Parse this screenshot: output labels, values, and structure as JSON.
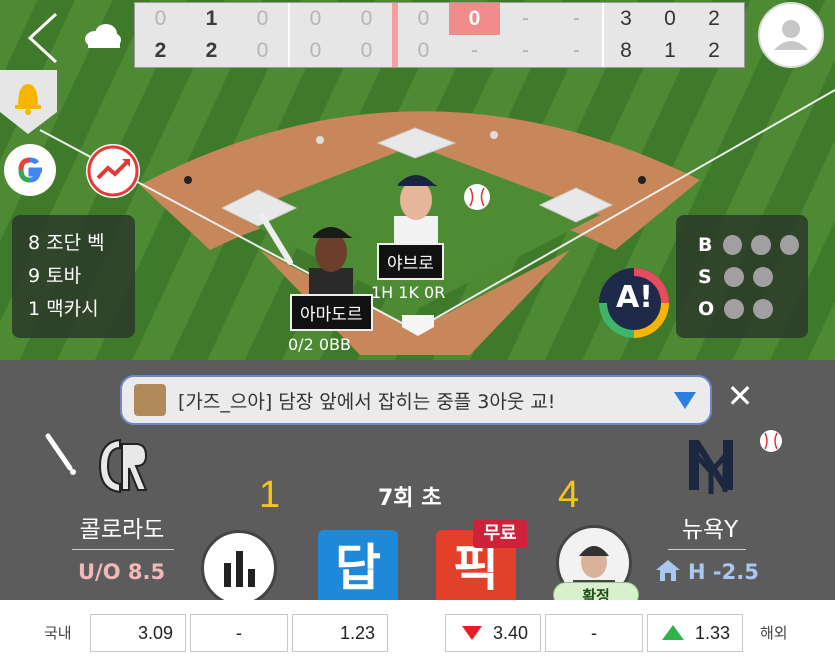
{
  "scoreboard": {
    "away_innings": [
      "0",
      "1",
      "0",
      "0",
      "0",
      "0",
      "0",
      "-",
      "-"
    ],
    "home_innings": [
      "2",
      "2",
      "0",
      "0",
      "0",
      "0",
      "-",
      "-",
      "-"
    ],
    "away_totals": [
      "3",
      "0",
      "2"
    ],
    "home_totals": [
      "8",
      "1",
      "2"
    ]
  },
  "lineup": [
    "8 조단 벡",
    "9 토바",
    "1 맥카시"
  ],
  "bso": {
    "balls": "B",
    "strikes": "S",
    "outs": "O"
  },
  "players": {
    "pitcher": {
      "name": "야브로",
      "stat": "1H 1K 0R"
    },
    "batter": {
      "name": "아마도르",
      "stat": "0/2 0BB"
    }
  },
  "ai_badge": "A!",
  "chat": {
    "text": "[가즈_으아] 담장 앞에서 잡히는 중플 3아웃 교!",
    "close": "✕"
  },
  "game": {
    "away_team": "콜로라도",
    "home_team": "뉴욕Y",
    "away_score": "1",
    "home_score": "4",
    "inning": "7회 초",
    "away_odds": "U/O 8.5",
    "home_odds": "H -2.5",
    "away_logo": "CR",
    "home_logo": "NY"
  },
  "buttons": {
    "answer": "답",
    "pick": "픽",
    "free": "무료",
    "confirm": "확정"
  },
  "odds": {
    "domestic_label": "국내",
    "overseas_label": "해외",
    "domestic": [
      "3.09",
      "-",
      "1.23"
    ],
    "overseas": [
      "3.40",
      "-",
      "1.33"
    ]
  },
  "colors": {
    "grass": "#4d8a33",
    "dirt": "#c8875a",
    "panel": "#5c5c5c",
    "score_yellow": "#f5c518",
    "away_odds_pink": "#f2b8b8",
    "home_odds_blue": "#a8c8f0",
    "answer_blue": "#1e88d9",
    "pick_red": "#e2402a"
  }
}
